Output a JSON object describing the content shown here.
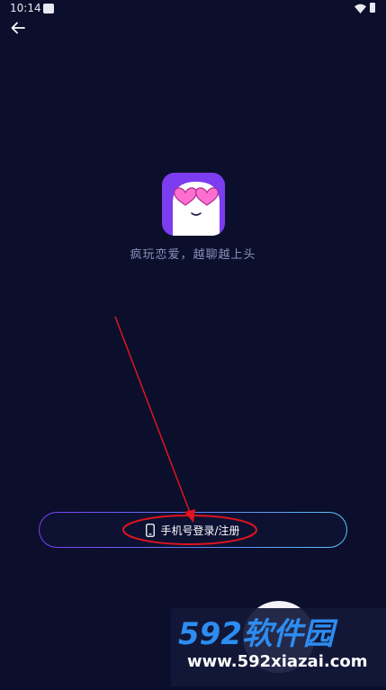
{
  "status_bar": {
    "time": "10:14",
    "icons": [
      "notification-icon",
      "wifi-icon",
      "battery-icon"
    ]
  },
  "header": {
    "back_icon": "arrow-left-icon"
  },
  "brand": {
    "logo_icon": "heart-sunglasses-ghost-icon",
    "tagline": "疯玩恋爱，越聊越上头"
  },
  "login": {
    "icon": "phone-icon",
    "label": "手机号登录/注册"
  },
  "watermark": {
    "logo_text": "592软件园",
    "url": "www.592xiazai.com"
  },
  "colors": {
    "background": "#0b0f2c",
    "accent_purple": "#7c3cf0",
    "accent_blue": "#59c6f7",
    "annotation_red": "#e0141e",
    "watermark_blue": "#2d8cf0"
  }
}
